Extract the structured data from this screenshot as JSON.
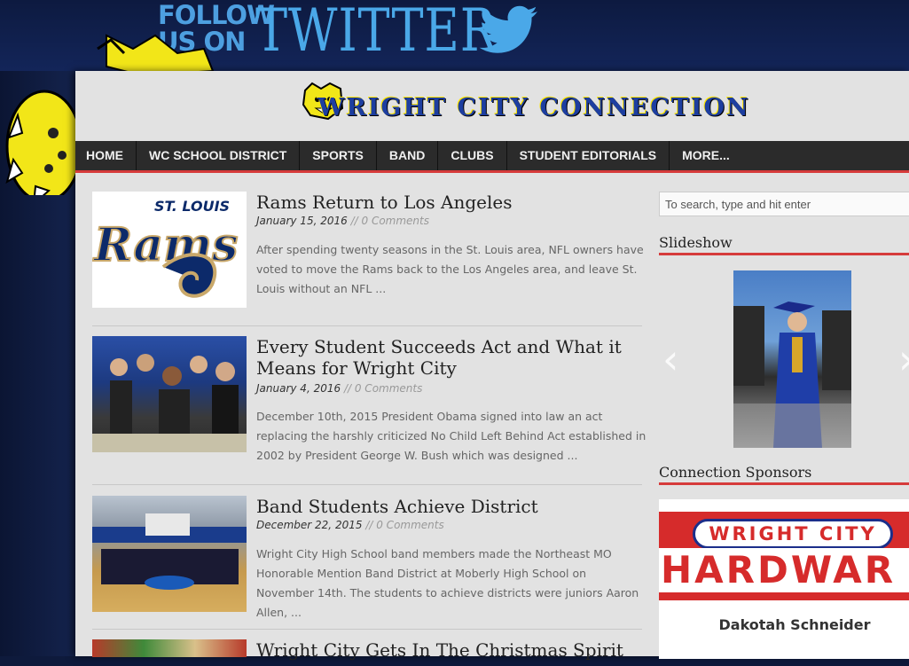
{
  "banner": {
    "follow_line1": "FOLLOW",
    "follow_line2": "US ON",
    "twitter": "TWITTER",
    "bird_icon": "twitter-bird-icon"
  },
  "site": {
    "logo_text": "WRIGHT CITY CONNECTION"
  },
  "nav": {
    "items": [
      {
        "label": "HOME"
      },
      {
        "label": "WC SCHOOL DISTRICT"
      },
      {
        "label": "SPORTS"
      },
      {
        "label": "BAND"
      },
      {
        "label": "CLUBS"
      },
      {
        "label": "STUDENT EDITORIALS"
      },
      {
        "label": "MORE..."
      }
    ],
    "accent": "#d63b3b"
  },
  "posts": [
    {
      "title": "Rams Return to Los Angeles",
      "date": "January 15, 2016",
      "sep": "//",
      "comments": "0 Comments",
      "excerpt": "After spending twenty seasons in the St. Louis area,  NFL owners have voted to move the Rams back to the Los Angeles area, and leave St. Louis without an NFL ...",
      "thumb_top": "ST. LOUIS",
      "thumb_word": "Rams"
    },
    {
      "title": "Every Student Succeeds Act and What it Means for Wright City",
      "date": "January 4, 2016",
      "sep": "//",
      "comments": "0 Comments",
      "excerpt": "December 10th, 2015 President Obama signed into law an act replacing the harshly criticized No Child Left Behind Act established in 2002 by President George W. Bush which was designed ..."
    },
    {
      "title": "Band Students Achieve District",
      "date": "December 22, 2015",
      "sep": "//",
      "comments": "0 Comments",
      "excerpt": "Wright City High School band members made the Northeast MO Honorable Mention Band District at Moberly High School on November 14th. The students to achieve districts were juniors Aaron Allen, ..."
    },
    {
      "title": "Wright City Gets In The Christmas Spirit"
    }
  ],
  "sidebar": {
    "search_placeholder": "To search, type and hit enter",
    "slideshow_heading": "Slideshow",
    "prev_arrow": "‹",
    "next_arrow": "›",
    "sponsors_heading": "Connection Sponsors",
    "sponsor": {
      "line1": "WRIGHT CITY",
      "line2": "HARDWAR",
      "name": "Dakotah Schneider"
    }
  }
}
